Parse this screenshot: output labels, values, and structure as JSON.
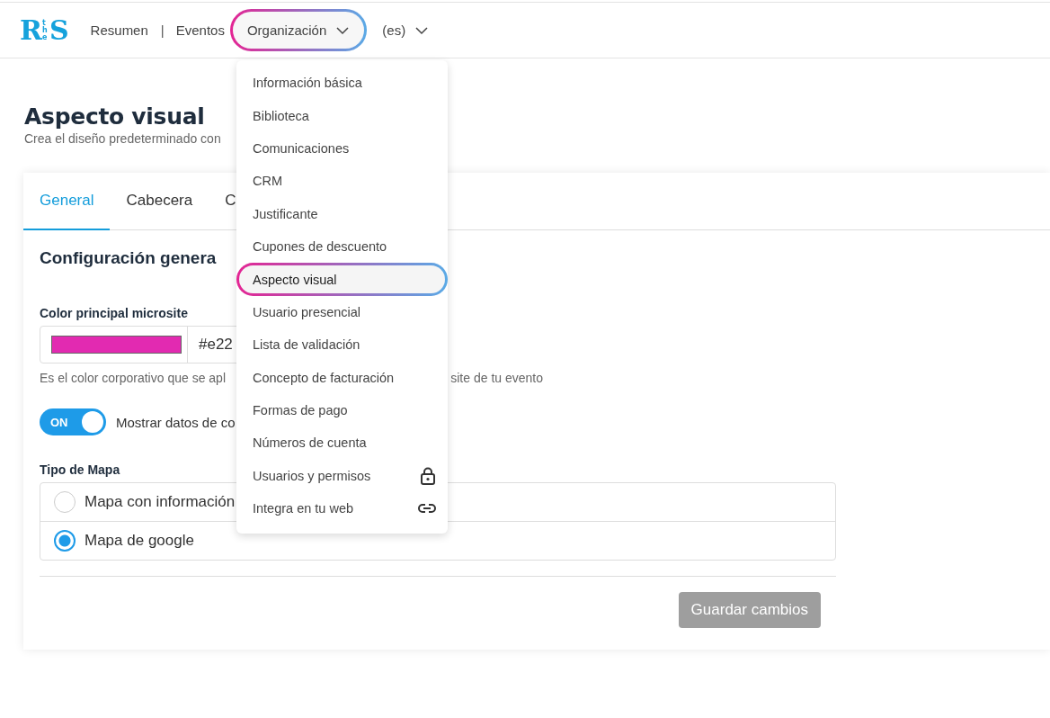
{
  "header": {
    "logo": {
      "big_left": "R",
      "small": "the",
      "big_right": "S"
    },
    "separator": "|",
    "nav": [
      {
        "label": "Resumen",
        "kind": "link",
        "open": false
      },
      {
        "label": "Eventos",
        "kind": "link",
        "open": false
      },
      {
        "label": "Organización",
        "kind": "dropdown",
        "open": true
      },
      {
        "label": "(es)",
        "kind": "dropdown",
        "open": false
      }
    ]
  },
  "page": {
    "title": "Aspecto visual",
    "subtitle": "Crea el diseño predeterminado con"
  },
  "tabs": [
    {
      "label": "General",
      "selected": true
    },
    {
      "label": "Cabecera",
      "selected": false
    },
    {
      "label": "C",
      "selected": false
    }
  ],
  "section": {
    "heading": "Configuración genera",
    "color_field": {
      "label": "Color principal microsite",
      "value": "#e22",
      "help_left": "Es el color corporativo que se apl",
      "help_right": "site de tu evento"
    },
    "toggle": {
      "on": true,
      "state_label": "ON",
      "label": "Mostrar datos de co"
    },
    "map_type": {
      "label": "Tipo de Mapa",
      "options": [
        {
          "label": "Mapa con información",
          "selected": false
        },
        {
          "label": "Mapa de google",
          "selected": true
        }
      ]
    },
    "save_button": {
      "label": "Guardar cambios",
      "disabled": true
    }
  },
  "dropdown_menu": {
    "items": [
      {
        "label": "Información básica",
        "selected": false,
        "kind": "plain"
      },
      {
        "label": "Biblioteca",
        "selected": false,
        "kind": "plain"
      },
      {
        "label": "Comunicaciones",
        "selected": false,
        "kind": "plain"
      },
      {
        "label": "CRM",
        "selected": false,
        "kind": "plain"
      },
      {
        "label": "Justificante",
        "selected": false,
        "kind": "plain"
      },
      {
        "label": "Cupones de descuento",
        "selected": false,
        "kind": "plain"
      },
      {
        "label": "Aspecto visual",
        "selected": true,
        "kind": "plain"
      },
      {
        "label": "Usuario presencial",
        "selected": false,
        "kind": "plain"
      },
      {
        "label": "Lista de validación",
        "selected": false,
        "kind": "plain"
      },
      {
        "label": "Concepto de facturación",
        "selected": false,
        "kind": "plain"
      },
      {
        "label": "Formas de pago",
        "selected": false,
        "kind": "plain"
      },
      {
        "label": "Números de cuenta",
        "selected": false,
        "kind": "plain"
      },
      {
        "label": "Usuarios y permisos",
        "selected": false,
        "kind": "lock"
      },
      {
        "label": "Integra en tu web",
        "selected": false,
        "kind": "link"
      }
    ]
  }
}
